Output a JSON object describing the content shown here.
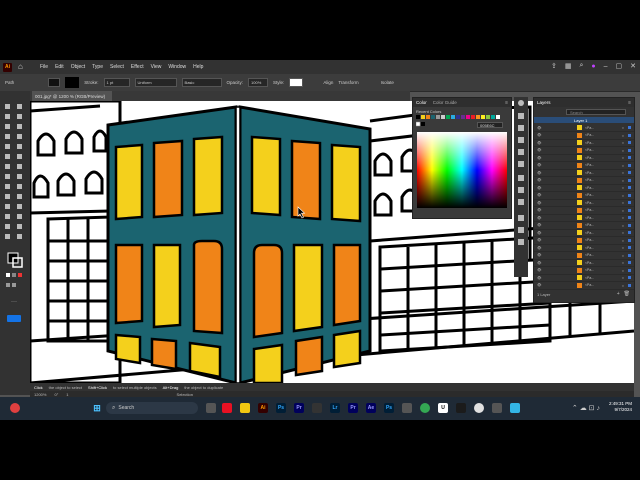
{
  "menubar": {
    "app_icon": "Ai",
    "items": [
      "File",
      "Edit",
      "Object",
      "Type",
      "Select",
      "Effect",
      "View",
      "Window",
      "Help"
    ]
  },
  "controlbar": {
    "selection": "Path",
    "stroke_label": "Stroke:",
    "stroke_value": "1 pt",
    "uniform": "Uniform",
    "basic": "Basic",
    "opacity_label": "Opacity:",
    "opacity_value": "100%",
    "style_label": "Style:",
    "align": "Align",
    "transform": "Transform",
    "isolate": "Isolate"
  },
  "document": {
    "tab": "001.jpg* @ 1200 % (RGB/Preview)"
  },
  "color_panel": {
    "tab_color": "Color",
    "tab_color_guide": "Color Guide",
    "recent_colors": "Recent Colors",
    "hex": "005E6C",
    "swatches": [
      "#000000",
      "#ffffff",
      "#1a1a1a",
      "#ff0000",
      "#00a651",
      "#2e3192",
      "#f7ed00",
      "#ff9900",
      "#ff3399",
      "#0099ff",
      "#66cc33",
      "#9933cc",
      "#996633",
      "#00cccc",
      "#ffcc00",
      "#cccccc"
    ]
  },
  "layers": {
    "title": "Layers",
    "search_placeholder": "Search",
    "layer_name": "Layer 1",
    "sublayer_label": "<Pa...",
    "count": "1 Layer",
    "rows": 22
  },
  "status": {
    "hint1": "Click",
    "hint1b": "the object to select",
    "hint2": "Shift+Click",
    "hint2b": "to select multiple objects",
    "hint3": "Alt+Drag",
    "hint3b": "the object to duplicate",
    "zoom": "1200%",
    "angle": "0°",
    "page": "1",
    "mode": "Selection"
  },
  "taskbar": {
    "search_placeholder": "Search",
    "time": "2:49:31 PM",
    "date": "9/7/2024"
  },
  "colors": {
    "building_teal": "#1b6470",
    "window_yellow": "#f4d01c",
    "window_orange": "#f08418"
  }
}
